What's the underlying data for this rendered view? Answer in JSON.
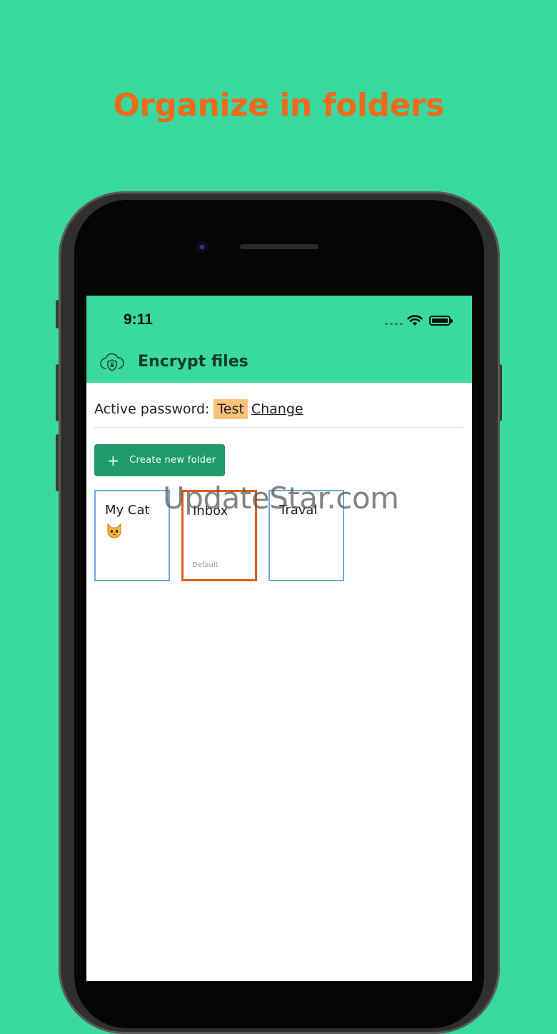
{
  "headline": "Organize in folders",
  "status_bar": {
    "time": "9:11"
  },
  "app_bar": {
    "title": "Encrypt files",
    "icon": "cloud-lock-icon"
  },
  "password_row": {
    "label": "Active password:",
    "value": "Test",
    "change_link": "Change"
  },
  "create_folder_button": {
    "label": "Create new folder",
    "icon": "plus-icon"
  },
  "folders": [
    {
      "name": "My Cat",
      "emoji_icon": "cat-face-icon",
      "subtitle": ""
    },
    {
      "name": "Inbox",
      "subtitle": "Default"
    },
    {
      "name": "Traval",
      "subtitle": ""
    }
  ],
  "watermark": "UpdateStar.com",
  "colors": {
    "background": "#3ad99f",
    "headline": "#f26a1b",
    "primary_button": "#1f9b6c",
    "password_highlight": "#ffc27a",
    "folder_border": "#6fa6e6",
    "default_folder_border": "#dc5f1b"
  }
}
